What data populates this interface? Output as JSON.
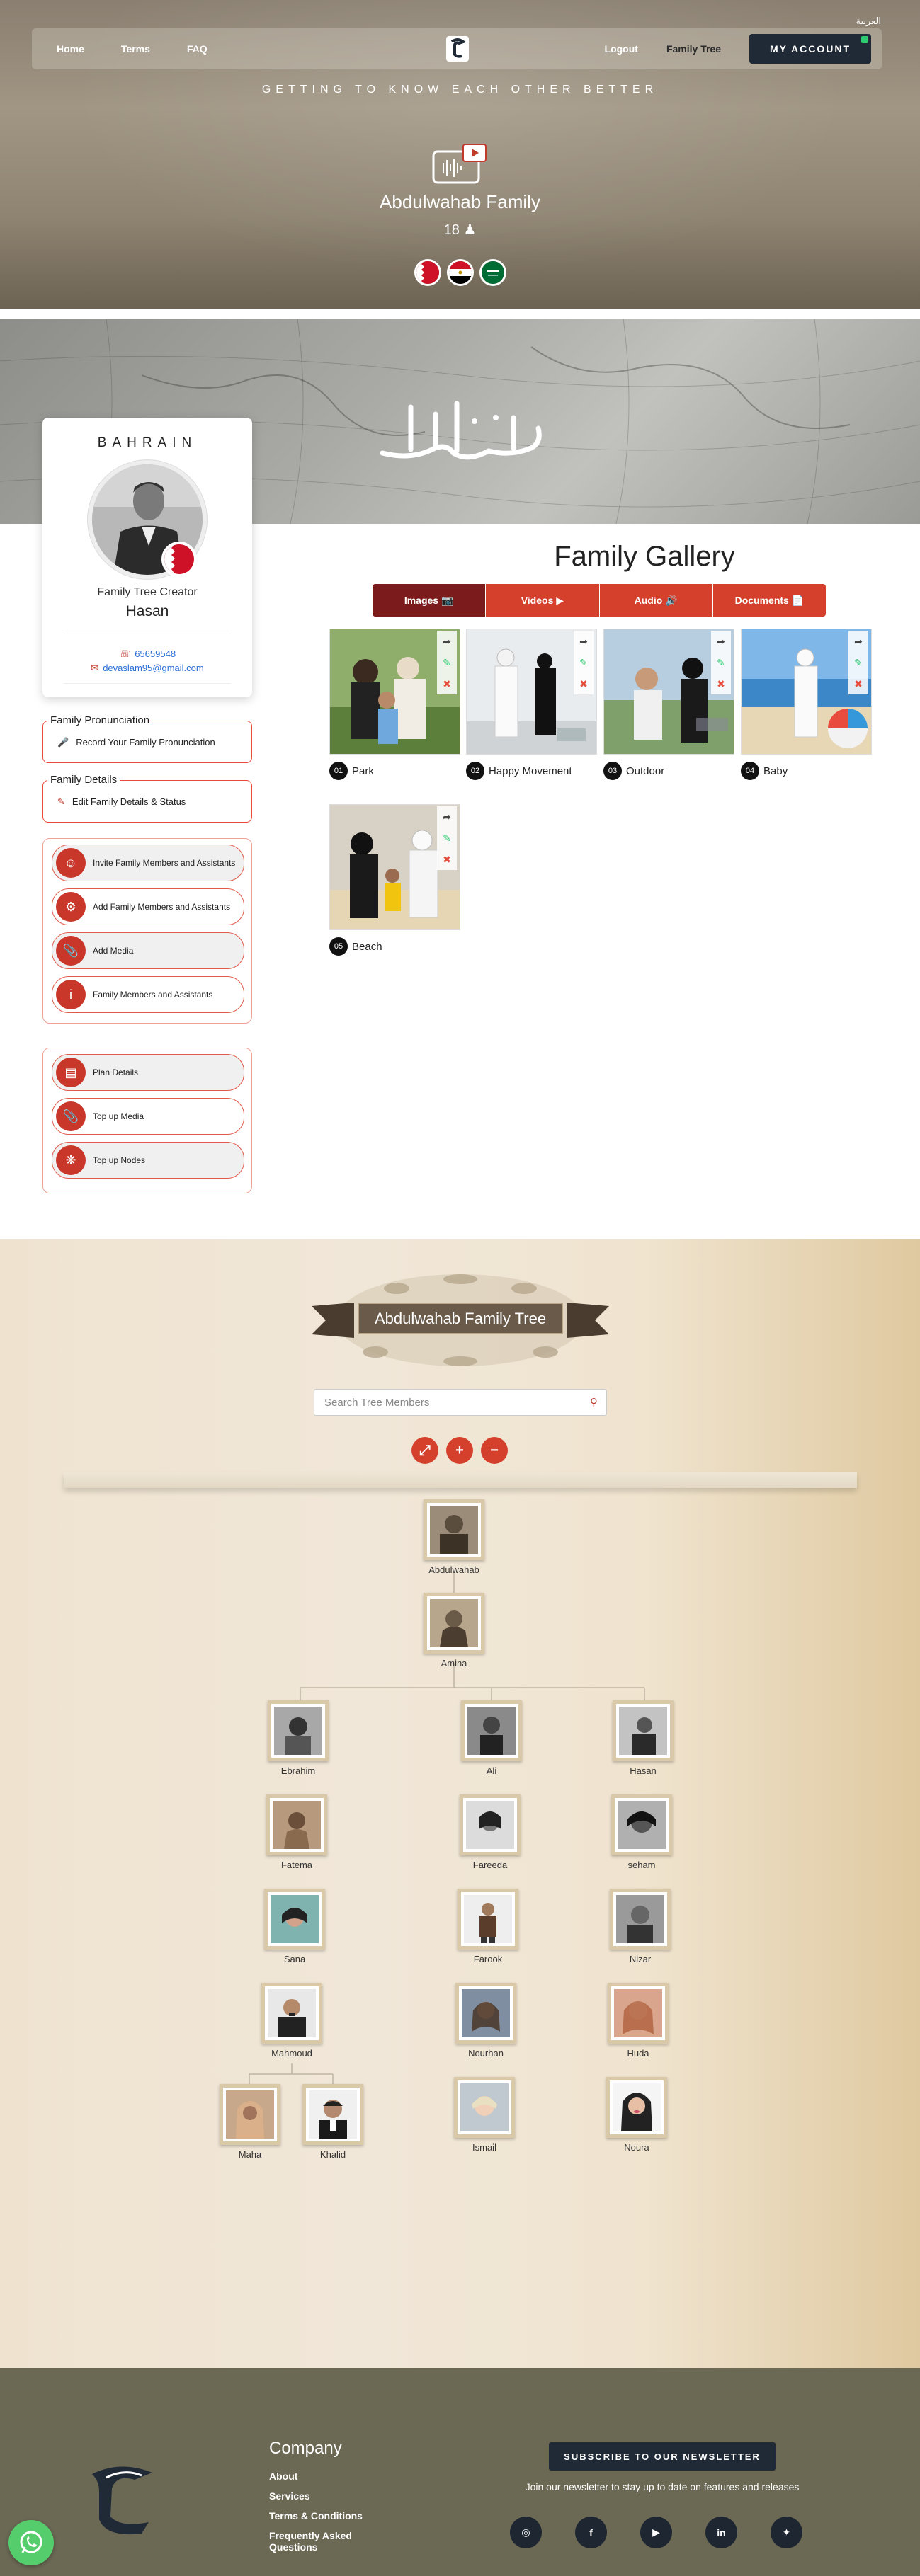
{
  "header": {
    "language_link": "العربية",
    "nav_left": [
      "Home",
      "Terms",
      "FAQ"
    ],
    "nav_logout": "Logout",
    "nav_family_tree": "Family Tree",
    "account_button": "MY ACCOUNT",
    "tagline": "GETTING TO KNOW EACH OTHER BETTER",
    "family_name": "Abdulwahab Family",
    "member_count": "18",
    "flags": [
      "bahrain-flag",
      "egypt-flag",
      "saudi-flag"
    ]
  },
  "banner": {
    "calligraphy_icon": "arabic-calligraphy-logo"
  },
  "profile": {
    "country": "BAHRAIN",
    "role": "Family Tree Creator",
    "name": "Hasan",
    "phone": "65659548",
    "email": "devaslam95@gmail.com"
  },
  "pronunciation": {
    "legend": "Family Pronunciation",
    "action": "Record Your Family Pronunciation"
  },
  "details": {
    "legend": "Family Details",
    "action": "Edit Family Details & Status"
  },
  "menu_primary": [
    {
      "label": "Invite Family Members and Assistants",
      "icon": "user-icon"
    },
    {
      "label": "Add Family Members and Assistants",
      "icon": "sitemap-icon"
    },
    {
      "label": "Add Media",
      "icon": "paperclip-icon"
    },
    {
      "label": "Family Members and Assistants",
      "icon": "info-icon"
    }
  ],
  "menu_secondary": [
    {
      "label": "Plan Details",
      "icon": "calendar-icon"
    },
    {
      "label": "Top up Media",
      "icon": "paperclip-icon"
    },
    {
      "label": "Top up Nodes",
      "icon": "network-icon"
    }
  ],
  "gallery": {
    "title": "Family Gallery",
    "tabs": [
      "Images",
      "Videos",
      "Audio",
      "Documents"
    ],
    "items": [
      {
        "num": "01",
        "caption": "Park"
      },
      {
        "num": "02",
        "caption": "Happy Movement"
      },
      {
        "num": "03",
        "caption": "Outdoor"
      },
      {
        "num": "04",
        "caption": "Baby"
      },
      {
        "num": "05",
        "caption": "Beach"
      }
    ]
  },
  "tree": {
    "title": "Abdulwahab Family Tree",
    "search_placeholder": "Search Tree Members",
    "controls": [
      "expand-icon",
      "plus-icon",
      "minus-icon"
    ],
    "members": {
      "abdulwahab": "Abdulwahab",
      "amina": "Amina",
      "ebrahim": "Ebrahim",
      "ali": "Ali",
      "hasan": "Hasan",
      "fatema": "Fatema",
      "fareeda": "Fareeda",
      "seham": "seham",
      "sana": "Sana",
      "farook": "Farook",
      "nizar": "Nizar",
      "mahmoud": "Mahmoud",
      "nourhan": "Nourhan",
      "huda": "Huda",
      "maha": "Maha",
      "khalid": "Khalid",
      "ismail": "Ismail",
      "noura": "Noura"
    }
  },
  "footer": {
    "company_heading": "Company",
    "links": [
      "About",
      "Services",
      "Terms & Conditions",
      "Frequently Asked Questions"
    ],
    "subscribe_button": "SUBSCRIBE TO OUR NEWSLETTER",
    "subscribe_text": "Join our newsletter to stay up to date on features and releases",
    "socials": [
      "instagram-icon",
      "facebook-icon",
      "youtube-icon",
      "linkedin-icon",
      "twitter-icon"
    ]
  },
  "colors": {
    "accent_red": "#d4402c",
    "dark_red": "#7c1b1b",
    "navy": "#1f2a36",
    "footer_bg": "#6b6854"
  }
}
